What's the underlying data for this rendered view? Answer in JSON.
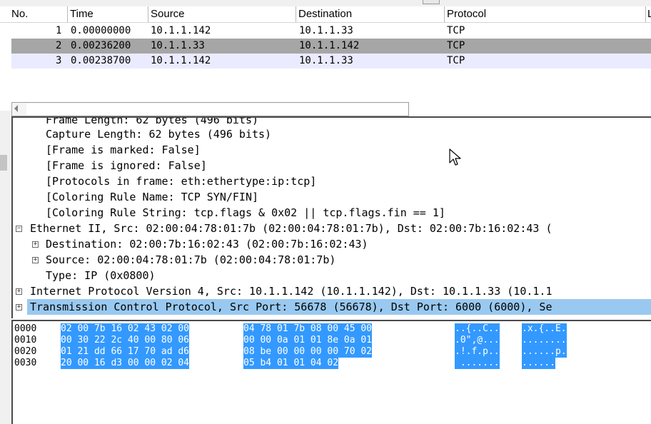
{
  "packet_list": {
    "columns": [
      "No.",
      "Time",
      "Source",
      "Destination",
      "Protocol",
      "L"
    ],
    "rows": [
      {
        "no": "1",
        "time": "0.00000000",
        "source": "10.1.1.142",
        "destination": "10.1.1.33",
        "protocol": "TCP"
      },
      {
        "no": "2",
        "time": "0.00236200",
        "source": "10.1.1.33",
        "destination": "10.1.1.142",
        "protocol": "TCP"
      },
      {
        "no": "3",
        "time": "0.00238700",
        "source": "10.1.1.142",
        "destination": "10.1.1.33",
        "protocol": "TCP"
      }
    ],
    "selected_row": 2
  },
  "details": {
    "lines": [
      "Frame Length: 62 bytes (496 bits)",
      "Capture Length: 62 bytes (496 bits)",
      "[Frame is marked: False]",
      "[Frame is ignored: False]",
      "[Protocols in frame: eth:ethertype:ip:tcp]",
      "[Coloring Rule Name: TCP SYN/FIN]",
      "[Coloring Rule String: tcp.flags & 0x02 || tcp.flags.fin == 1]",
      "Ethernet II, Src: 02:00:04:78:01:7b (02:00:04:78:01:7b), Dst: 02:00:7b:16:02:43 (",
      "Destination: 02:00:7b:16:02:43 (02:00:7b:16:02:43)",
      "Source: 02:00:04:78:01:7b (02:00:04:78:01:7b)",
      "Type: IP (0x0800)",
      "Internet Protocol Version 4, Src: 10.1.1.142 (10.1.1.142), Dst: 10.1.1.33 (10.1.1",
      "Transmission Control Protocol, Src Port: 56678 (56678), Dst Port: 6000 (6000), Se"
    ],
    "expander_symbols": {
      "collapsed": "+",
      "expanded": "−"
    }
  },
  "bytes": {
    "rows": [
      {
        "offset": "0000",
        "hex1": "02 00 7b 16 02 43 02 00",
        "hex2": "04 78 01 7b 08 00 45 00",
        "ascii1": "..{..C..",
        "ascii2": ".x.{..E."
      },
      {
        "offset": "0010",
        "hex1": "00 30 22 2c 40 00 80 06",
        "hex2": "00 00 0a 01 01 8e 0a 01",
        "ascii1": ".0\",@...",
        "ascii2": "........"
      },
      {
        "offset": "0020",
        "hex1": "01 21 dd 66 17 70 ad d6",
        "hex2": "08 be 00 00 00 00 70 02",
        "ascii1": ".!.f.p..",
        "ascii2": "......p."
      },
      {
        "offset": "0030",
        "hex1": "20 00 16 d3 00 00 02 04",
        "hex2": "05 b4 01 01 04 02",
        "ascii1": " .......",
        "ascii2": "......"
      }
    ]
  },
  "colors": {
    "selected_row_bg": "#a6a6a6",
    "row3_bg": "#ebebff",
    "tcp_highlight_bg": "#99c9f0",
    "bytes_selection_bg": "#3399ff"
  },
  "icons": {
    "cursor": "mouse-pointer-icon",
    "scroll_left": "arrow-left-icon"
  }
}
